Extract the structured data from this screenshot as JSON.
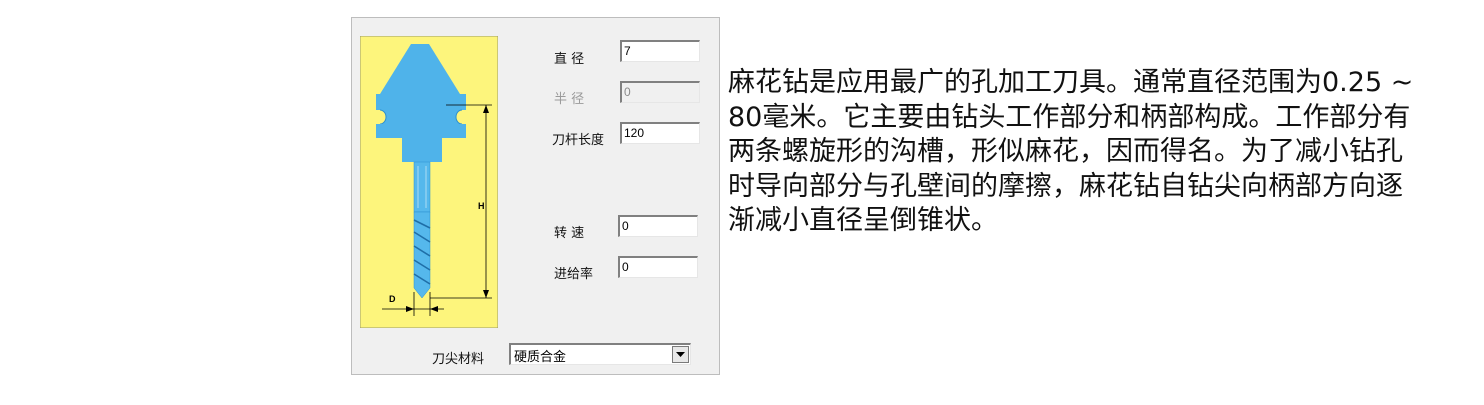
{
  "dialog": {
    "fields": {
      "diameter": {
        "label": "直 径",
        "value": "7"
      },
      "radius": {
        "label": "半 径",
        "value": "0"
      },
      "tool_length": {
        "label": "刀杆长度",
        "value": "120"
      },
      "spindle_speed": {
        "label": "转 速",
        "value": "0"
      },
      "feed_rate": {
        "label": "进给率",
        "value": "0"
      }
    },
    "tip_material": {
      "label": "刀尖材料",
      "selected": "硬质合金"
    },
    "diagram": {
      "dimension_labels": {
        "height": "H",
        "diameter": "D"
      },
      "colors": {
        "background": "#fdf57c",
        "tool": "#4fb3ea",
        "tool_shade": "#2b8fcf"
      }
    }
  },
  "description": "麻花钻是应用最广的孔加工刀具。通常直径范围为0.25 ~ 80毫米。它主要由钻头工作部分和柄部构成。工作部分有两条螺旋形的沟槽，形似麻花，因而得名。为了减小钻孔时导向部分与孔壁间的摩擦，麻花钻自钻尖向柄部方向逐渐减小直径呈倒锥状。"
}
